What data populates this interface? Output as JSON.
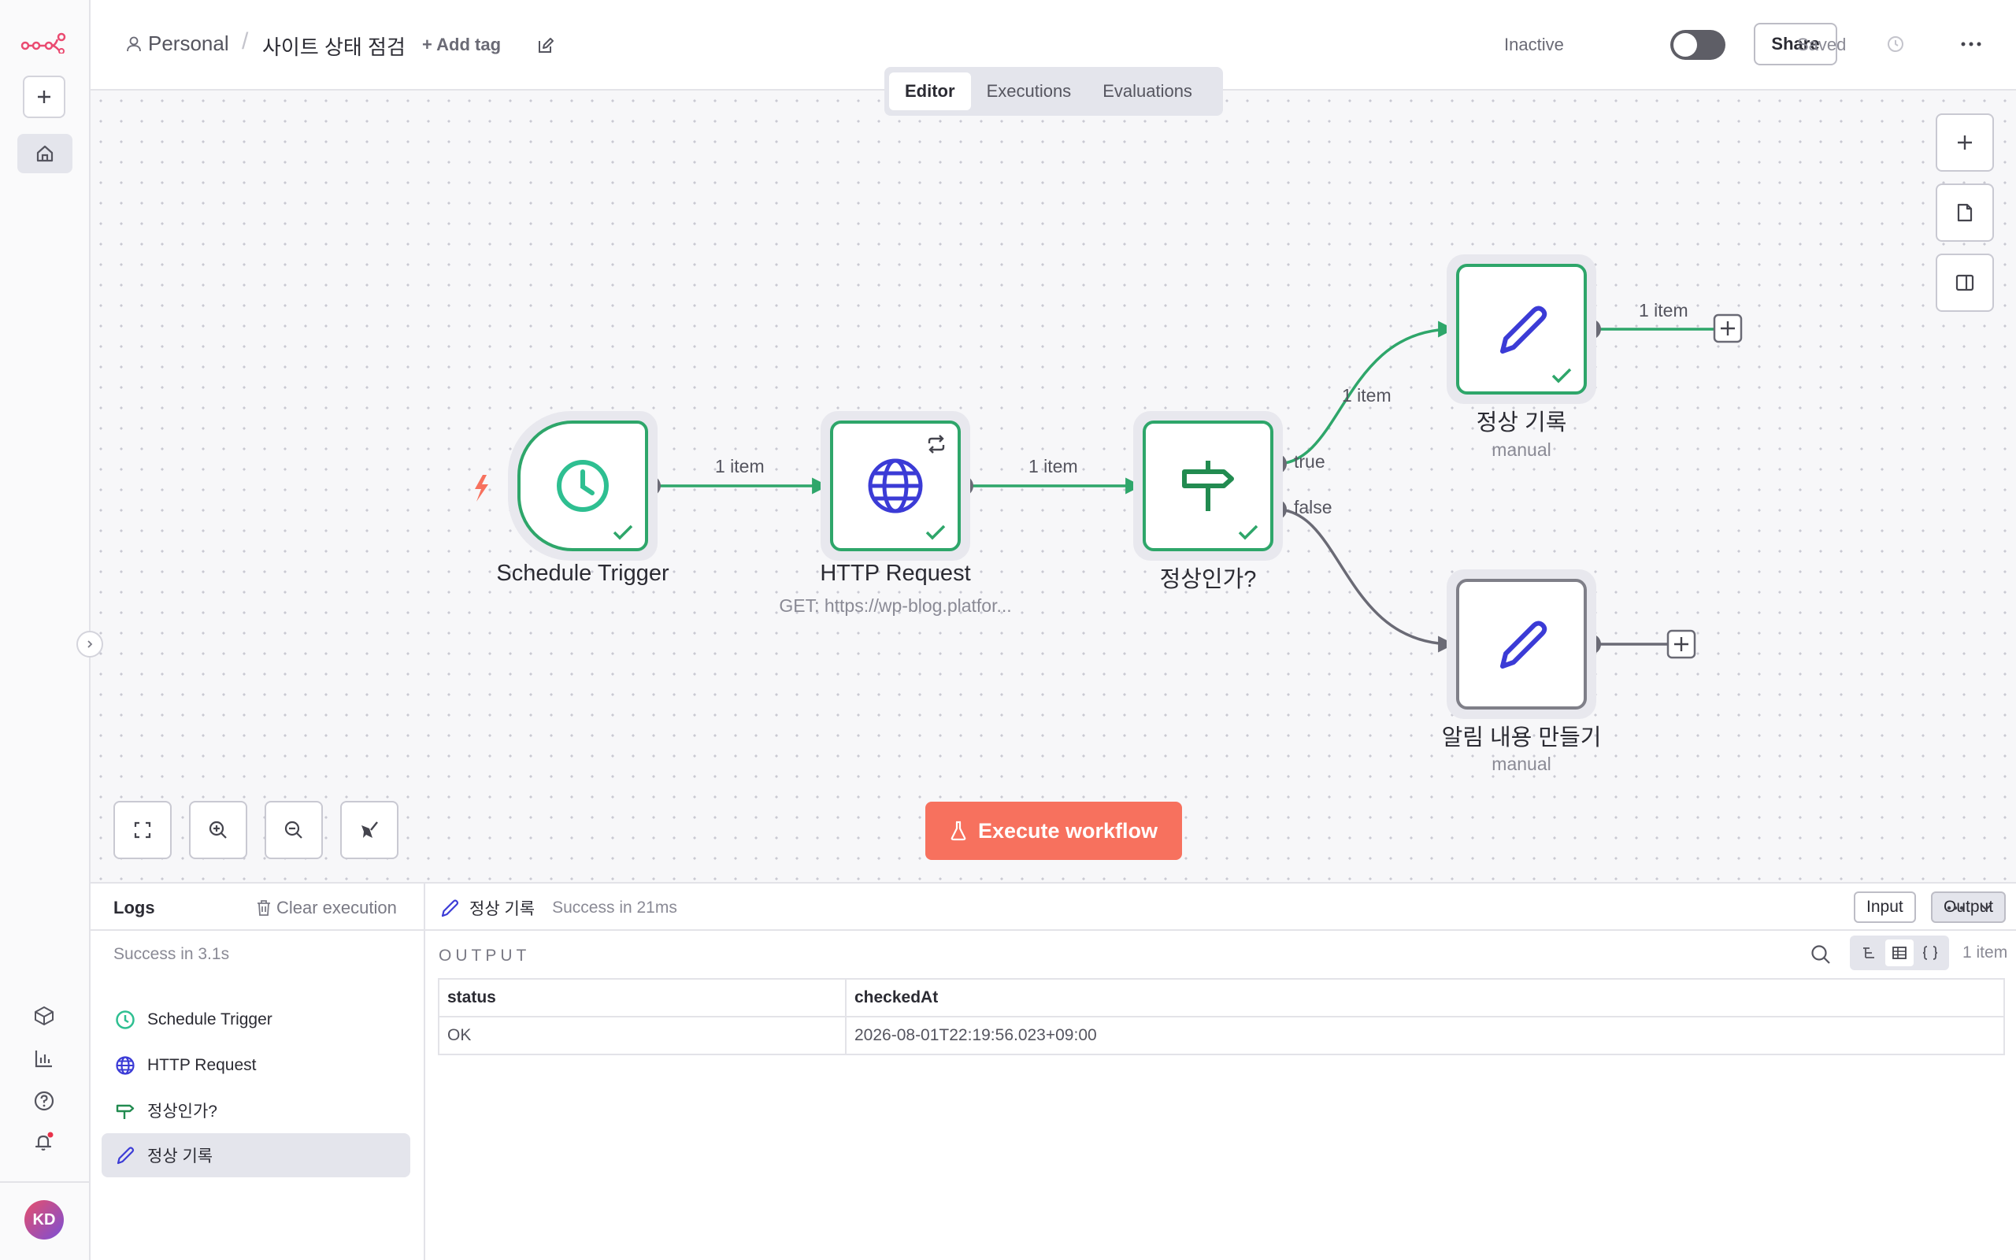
{
  "header": {
    "project": "Personal",
    "separator": "/",
    "workflow_name": "사이트 상태 점검",
    "add_tag": "+ Add tag",
    "status_label": "Inactive",
    "share_label": "Share",
    "saved_label": "Saved"
  },
  "tabs": [
    {
      "label": "Editor",
      "active": true
    },
    {
      "label": "Executions",
      "active": false
    },
    {
      "label": "Evaluations",
      "active": false
    }
  ],
  "nodes": {
    "schedule": {
      "label": "Schedule Trigger"
    },
    "http": {
      "label": "HTTP Request",
      "subtitle": "GET: https://wp-blog.platfor..."
    },
    "if": {
      "label": "정상인가?"
    },
    "normal": {
      "label": "정상 기록",
      "subtitle": "manual"
    },
    "alert": {
      "label": "알림 내용 만들기",
      "subtitle": "manual"
    }
  },
  "connections": {
    "trigger_to_http": "1 item",
    "http_to_if": "1 item",
    "if_true_count": "1 item",
    "if_true": "true",
    "if_false": "false",
    "normal_out": "1 item"
  },
  "execute_button": "Execute workflow",
  "logs": {
    "title": "Logs",
    "clear": "Clear execution",
    "summary": "Success in 3.1s",
    "items": [
      {
        "label": "Schedule Trigger",
        "icon": "clock-icon"
      },
      {
        "label": "HTTP Request",
        "icon": "globe-icon"
      },
      {
        "label": "정상인가?",
        "icon": "signpost-icon"
      },
      {
        "label": "정상 기록",
        "icon": "pencil-icon",
        "selected": true
      }
    ]
  },
  "output_panel": {
    "node_name": "정상 기록",
    "status": "Success in 21ms",
    "input_label": "Input",
    "output_label": "Output",
    "section_title": "OUTPUT",
    "item_count": "1 item",
    "columns": [
      "status",
      "checkedAt"
    ],
    "rows": [
      [
        "OK",
        "2026-08-01T22:19:56.023+09:00"
      ]
    ]
  },
  "user": {
    "initials": "KD"
  },
  "colors": {
    "success_green": "#2ea66a",
    "execute_button": "#f7715e",
    "node_icon_blue": "#3b3bd6",
    "brand": "#ea4b71"
  }
}
